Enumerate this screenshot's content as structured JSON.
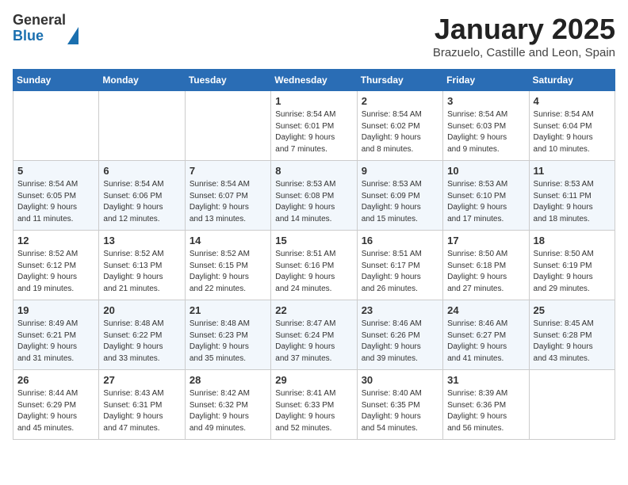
{
  "logo": {
    "general": "General",
    "blue": "Blue"
  },
  "header": {
    "month": "January 2025",
    "location": "Brazuelo, Castille and Leon, Spain"
  },
  "weekdays": [
    "Sunday",
    "Monday",
    "Tuesday",
    "Wednesday",
    "Thursday",
    "Friday",
    "Saturday"
  ],
  "weeks": [
    [
      {
        "day": "",
        "info": ""
      },
      {
        "day": "",
        "info": ""
      },
      {
        "day": "",
        "info": ""
      },
      {
        "day": "1",
        "info": "Sunrise: 8:54 AM\nSunset: 6:01 PM\nDaylight: 9 hours\nand 7 minutes."
      },
      {
        "day": "2",
        "info": "Sunrise: 8:54 AM\nSunset: 6:02 PM\nDaylight: 9 hours\nand 8 minutes."
      },
      {
        "day": "3",
        "info": "Sunrise: 8:54 AM\nSunset: 6:03 PM\nDaylight: 9 hours\nand 9 minutes."
      },
      {
        "day": "4",
        "info": "Sunrise: 8:54 AM\nSunset: 6:04 PM\nDaylight: 9 hours\nand 10 minutes."
      }
    ],
    [
      {
        "day": "5",
        "info": "Sunrise: 8:54 AM\nSunset: 6:05 PM\nDaylight: 9 hours\nand 11 minutes."
      },
      {
        "day": "6",
        "info": "Sunrise: 8:54 AM\nSunset: 6:06 PM\nDaylight: 9 hours\nand 12 minutes."
      },
      {
        "day": "7",
        "info": "Sunrise: 8:54 AM\nSunset: 6:07 PM\nDaylight: 9 hours\nand 13 minutes."
      },
      {
        "day": "8",
        "info": "Sunrise: 8:53 AM\nSunset: 6:08 PM\nDaylight: 9 hours\nand 14 minutes."
      },
      {
        "day": "9",
        "info": "Sunrise: 8:53 AM\nSunset: 6:09 PM\nDaylight: 9 hours\nand 15 minutes."
      },
      {
        "day": "10",
        "info": "Sunrise: 8:53 AM\nSunset: 6:10 PM\nDaylight: 9 hours\nand 17 minutes."
      },
      {
        "day": "11",
        "info": "Sunrise: 8:53 AM\nSunset: 6:11 PM\nDaylight: 9 hours\nand 18 minutes."
      }
    ],
    [
      {
        "day": "12",
        "info": "Sunrise: 8:52 AM\nSunset: 6:12 PM\nDaylight: 9 hours\nand 19 minutes."
      },
      {
        "day": "13",
        "info": "Sunrise: 8:52 AM\nSunset: 6:13 PM\nDaylight: 9 hours\nand 21 minutes."
      },
      {
        "day": "14",
        "info": "Sunrise: 8:52 AM\nSunset: 6:15 PM\nDaylight: 9 hours\nand 22 minutes."
      },
      {
        "day": "15",
        "info": "Sunrise: 8:51 AM\nSunset: 6:16 PM\nDaylight: 9 hours\nand 24 minutes."
      },
      {
        "day": "16",
        "info": "Sunrise: 8:51 AM\nSunset: 6:17 PM\nDaylight: 9 hours\nand 26 minutes."
      },
      {
        "day": "17",
        "info": "Sunrise: 8:50 AM\nSunset: 6:18 PM\nDaylight: 9 hours\nand 27 minutes."
      },
      {
        "day": "18",
        "info": "Sunrise: 8:50 AM\nSunset: 6:19 PM\nDaylight: 9 hours\nand 29 minutes."
      }
    ],
    [
      {
        "day": "19",
        "info": "Sunrise: 8:49 AM\nSunset: 6:21 PM\nDaylight: 9 hours\nand 31 minutes."
      },
      {
        "day": "20",
        "info": "Sunrise: 8:48 AM\nSunset: 6:22 PM\nDaylight: 9 hours\nand 33 minutes."
      },
      {
        "day": "21",
        "info": "Sunrise: 8:48 AM\nSunset: 6:23 PM\nDaylight: 9 hours\nand 35 minutes."
      },
      {
        "day": "22",
        "info": "Sunrise: 8:47 AM\nSunset: 6:24 PM\nDaylight: 9 hours\nand 37 minutes."
      },
      {
        "day": "23",
        "info": "Sunrise: 8:46 AM\nSunset: 6:26 PM\nDaylight: 9 hours\nand 39 minutes."
      },
      {
        "day": "24",
        "info": "Sunrise: 8:46 AM\nSunset: 6:27 PM\nDaylight: 9 hours\nand 41 minutes."
      },
      {
        "day": "25",
        "info": "Sunrise: 8:45 AM\nSunset: 6:28 PM\nDaylight: 9 hours\nand 43 minutes."
      }
    ],
    [
      {
        "day": "26",
        "info": "Sunrise: 8:44 AM\nSunset: 6:29 PM\nDaylight: 9 hours\nand 45 minutes."
      },
      {
        "day": "27",
        "info": "Sunrise: 8:43 AM\nSunset: 6:31 PM\nDaylight: 9 hours\nand 47 minutes."
      },
      {
        "day": "28",
        "info": "Sunrise: 8:42 AM\nSunset: 6:32 PM\nDaylight: 9 hours\nand 49 minutes."
      },
      {
        "day": "29",
        "info": "Sunrise: 8:41 AM\nSunset: 6:33 PM\nDaylight: 9 hours\nand 52 minutes."
      },
      {
        "day": "30",
        "info": "Sunrise: 8:40 AM\nSunset: 6:35 PM\nDaylight: 9 hours\nand 54 minutes."
      },
      {
        "day": "31",
        "info": "Sunrise: 8:39 AM\nSunset: 6:36 PM\nDaylight: 9 hours\nand 56 minutes."
      },
      {
        "day": "",
        "info": ""
      }
    ]
  ]
}
